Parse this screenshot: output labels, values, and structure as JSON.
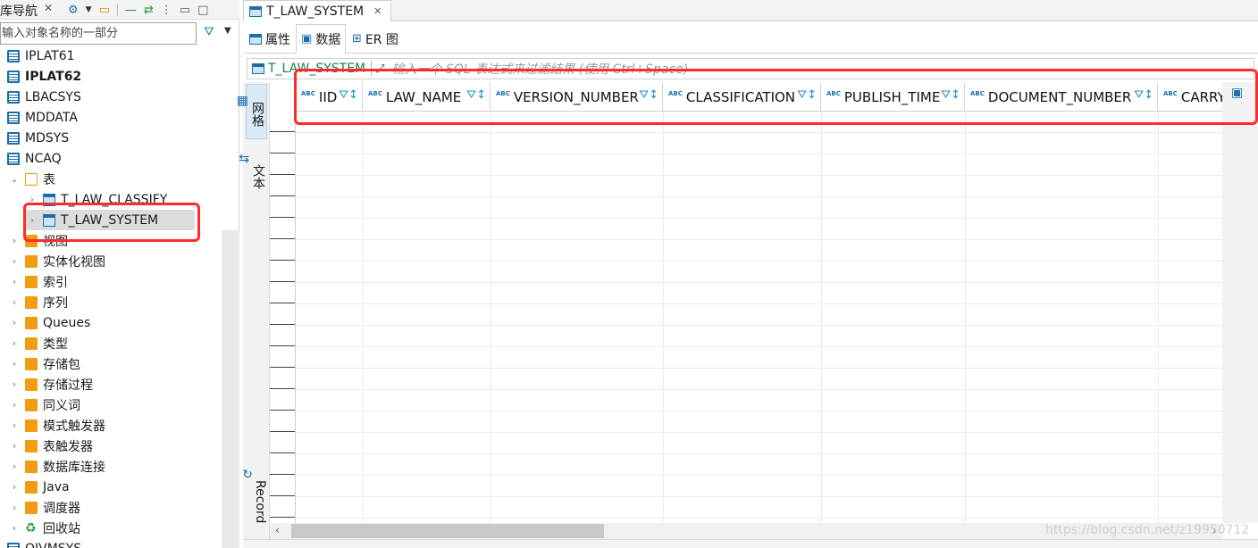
{
  "navigator": {
    "title": "库导航",
    "close": "✕",
    "filter_placeholder": "输入对象名称的一部分",
    "items": [
      {
        "label": "IPLAT61",
        "kind": "schema",
        "bold": false
      },
      {
        "label": "IPLAT62",
        "kind": "schema",
        "bold": true
      },
      {
        "label": "LBACSYS",
        "kind": "schema",
        "bold": false
      },
      {
        "label": "MDDATA",
        "kind": "schema",
        "bold": false
      },
      {
        "label": "MDSYS",
        "kind": "schema",
        "bold": false
      },
      {
        "label": "NCAQ",
        "kind": "schema",
        "bold": false
      },
      {
        "label": "表",
        "kind": "folder-open",
        "bold": false
      },
      {
        "label": "T_LAW_CLASSIFY",
        "kind": "table",
        "bold": false
      },
      {
        "label": "T_LAW_SYSTEM",
        "kind": "table",
        "bold": false,
        "selected": true
      },
      {
        "label": "视图",
        "kind": "folder",
        "bold": false
      },
      {
        "label": "实体化视图",
        "kind": "folder",
        "bold": false
      },
      {
        "label": "索引",
        "kind": "folder",
        "bold": false
      },
      {
        "label": "序列",
        "kind": "folder",
        "bold": false
      },
      {
        "label": "Queues",
        "kind": "folder",
        "bold": false
      },
      {
        "label": "类型",
        "kind": "folder",
        "bold": false
      },
      {
        "label": "存储包",
        "kind": "folder",
        "bold": false
      },
      {
        "label": "存储过程",
        "kind": "folder",
        "bold": false
      },
      {
        "label": "同义词",
        "kind": "folder",
        "bold": false
      },
      {
        "label": "模式触发器",
        "kind": "folder",
        "bold": false
      },
      {
        "label": "表触发器",
        "kind": "folder",
        "bold": false
      },
      {
        "label": "数据库连接",
        "kind": "folder",
        "bold": false
      },
      {
        "label": "Java",
        "kind": "folder",
        "bold": false
      },
      {
        "label": "调度器",
        "kind": "folder",
        "bold": false
      },
      {
        "label": "回收站",
        "kind": "recycle",
        "bold": false
      },
      {
        "label": "OJVMSYS",
        "kind": "schema",
        "bold": false
      }
    ]
  },
  "editor": {
    "tab_label": "T_LAW_SYSTEM",
    "tab_close": "✕",
    "subtabs": [
      "属性",
      "数据",
      "ER 图"
    ],
    "active_subtab": "数据",
    "filter_table": "T_LAW_SYSTEM",
    "filter_hint": "输入一个 SQL 表达式来过滤结果 (使用 Ctrl+Space)",
    "side_tabs": {
      "grid": "网格",
      "text": "文本",
      "record": "Record"
    },
    "columns": [
      {
        "name": "IID",
        "type_badge": "ABC"
      },
      {
        "name": "LAW_NAME",
        "type_badge": "ABC"
      },
      {
        "name": "VERSION_NUMBER",
        "type_badge": "ABC"
      },
      {
        "name": "CLASSIFICATION",
        "type_badge": "ABC"
      },
      {
        "name": "PUBLISH_TIME",
        "type_badge": "ABC"
      },
      {
        "name": "DOCUMENT_NUMBER",
        "type_badge": "ABC"
      },
      {
        "name": "CARRY",
        "type_badge": "ABC"
      }
    ]
  },
  "watermark": "https://blog.csdn.net/z19950712",
  "colors": {
    "highlight": "#ff2a2a",
    "accent": "#1b6ea8",
    "folder": "#f39c12"
  }
}
